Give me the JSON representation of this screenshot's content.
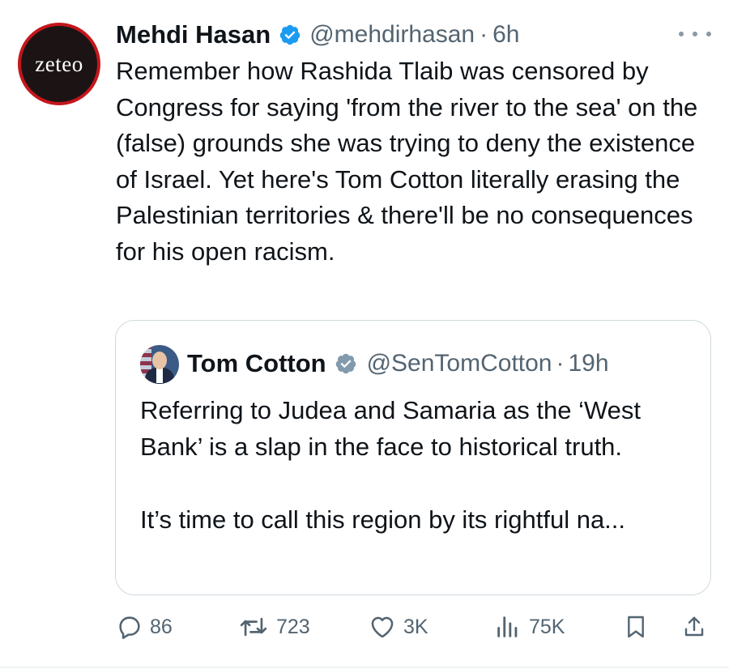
{
  "tweet": {
    "author_name": "Mehdi Hasan",
    "author_handle": "@mehdirhasan",
    "separator": "·",
    "time": "6h",
    "avatar_text": "zeteo",
    "verified_icon": "verified-badge-blue",
    "text": "Remember how Rashida Tlaib was censored by Congress for saying 'from the river to the sea' on the (false) grounds she was trying to deny the existence of Israel. Yet here's Tom Cotton literally erasing the Palestinian territories & there'll be no consequences for his open racism."
  },
  "quote": {
    "author_name": "Tom Cotton",
    "author_handle": "@SenTomCotton",
    "separator": "·",
    "time": "19h",
    "verified_icon": "verified-badge-gray",
    "paragraphs": [
      "Referring to Judea and Samaria as the ‘West Bank’ is a slap in the face to historical truth.",
      "It’s time to call this region by its rightful na..."
    ]
  },
  "actions": {
    "replies": "86",
    "reposts": "723",
    "likes": "3K",
    "views": "75K"
  },
  "colors": {
    "text": "#0f1419",
    "muted": "#536471",
    "blue_check": "#1d9bf0",
    "gray_check": "#829aab",
    "border": "#cfd9de",
    "avatar_ring": "#c4161c"
  }
}
